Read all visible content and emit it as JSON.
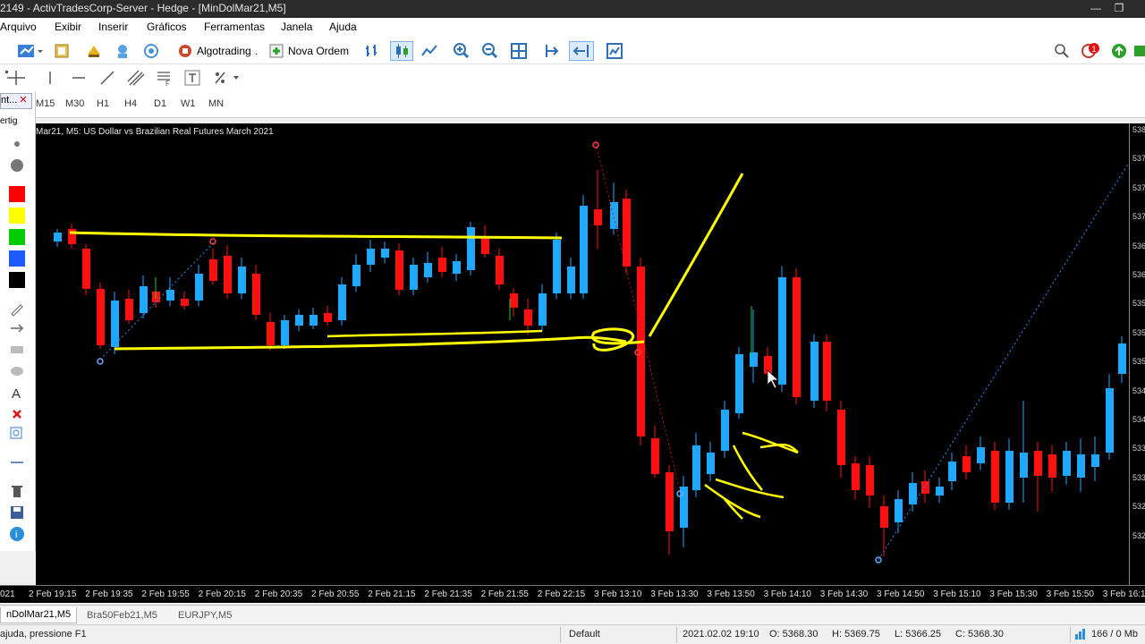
{
  "window": {
    "title": "2149 - ActivTradesCorp-Server - Hedge - [MinDolMar21,M5]",
    "controls": [
      "minimize-icon",
      "restore-icon"
    ]
  },
  "menu": [
    "Arquivo",
    "Exibir",
    "Inserir",
    "Gráficos",
    "Ferramentas",
    "Janela",
    "Ajuda"
  ],
  "toolbar": {
    "algotrading_label": "Algotrading",
    "new_order_label": "Nova Ordem",
    "notification_count": "1"
  },
  "timeframes": [
    "M15",
    "M30",
    "H1",
    "H4",
    "D1",
    "W1",
    "MN"
  ],
  "left_panel": {
    "tab_label": "nt...",
    "tab2_label": "ertig",
    "colors": [
      "#ff0000",
      "#ffff00",
      "#00cc00",
      "#1e5aff",
      "#000000"
    ]
  },
  "chart": {
    "title": "Mar21, M5:  US Dollar vs Brazilian Real Futures March 2021",
    "price_labels": [
      "538",
      "537",
      "537",
      "537",
      "536",
      "536",
      "535",
      "535",
      "535",
      "534",
      "534",
      "533",
      "533",
      "532",
      "532"
    ],
    "time_labels": [
      "021",
      "2 Feb 19:15",
      "2 Feb 19:35",
      "2 Feb 19:55",
      "2 Feb 20:15",
      "2 Feb 20:35",
      "2 Feb 20:55",
      "2 Feb 21:15",
      "2 Feb 21:35",
      "2 Feb 21:55",
      "2 Feb 22:15",
      "3 Feb 13:10",
      "3 Feb 13:30",
      "3 Feb 13:50",
      "3 Feb 14:10",
      "3 Feb 14:30",
      "3 Feb 14:50",
      "3 Feb 15:10",
      "3 Feb 15:30",
      "3 Feb 15:50",
      "3 Feb 16:1"
    ],
    "bull_color": "#1ea8ff",
    "bear_color": "#ff1010",
    "annotation_color": "#ffff00"
  },
  "chart_data": {
    "type": "candlestick",
    "symbol": "MinDolMar21",
    "timeframe": "M5",
    "title": "Mar21, M5:  US Dollar vs Brazilian Real Futures March 2021"
  },
  "tabs": [
    "nDolMar21,M5",
    "Bra50Feb21,M5",
    "EURJPY,M5"
  ],
  "status": {
    "help": "ajuda, pressione F1",
    "profile": "Default",
    "datetime": "2021.02.02 19:10",
    "open": "O: 5368.30",
    "high": "H: 5369.75",
    "low": "L: 5366.25",
    "close": "C: 5368.30",
    "traffic": "166 / 0 Mb"
  }
}
